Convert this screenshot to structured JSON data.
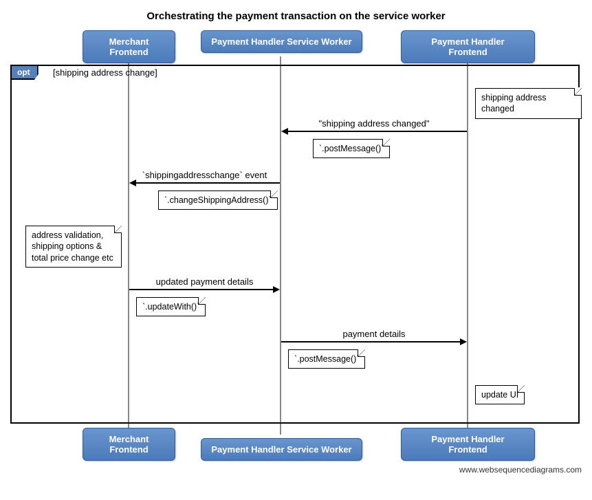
{
  "title": "Orchestrating the payment transaction on the service worker",
  "participants": {
    "p1": "Merchant Frontend",
    "p2": "Payment Handler Service Worker",
    "p3": "Payment Handler Frontend"
  },
  "frame": {
    "type": "opt",
    "guard": "[shipping address change]"
  },
  "notes": {
    "n1": "shipping address changed",
    "n2": "`.postMessage()`",
    "n3": "`.changeShippingAddress()`",
    "n4_l1": "address validation,",
    "n4_l2": "shipping options &",
    "n4_l3": "total price change etc",
    "n5": "`.updateWith()`",
    "n6": "`.postMessage()`",
    "n7": "update UI"
  },
  "messages": {
    "m1": "\"shipping address changed\"",
    "m2": "`shippingaddresschange` event",
    "m3": "updated payment details",
    "m4": "payment details"
  },
  "footer": "www.websequencediagrams.com"
}
